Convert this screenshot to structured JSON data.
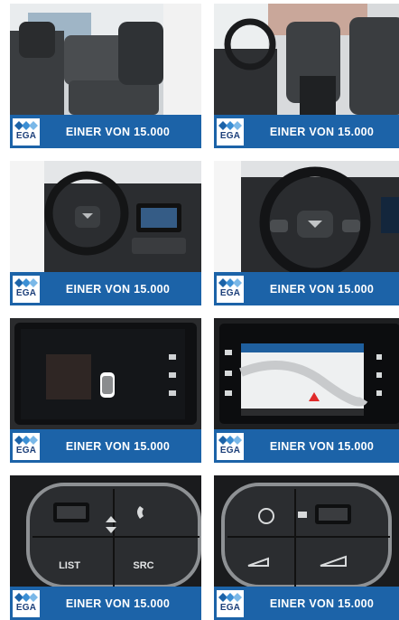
{
  "gallery": {
    "brand": {
      "logo_text": "EGA",
      "banner_color": "#1c63a8",
      "logo_color": "#1c3f7a"
    },
    "cards": [
      {
        "photo": "rear-seats",
        "tagline": "EINER VON 15.000"
      },
      {
        "photo": "front-seats",
        "tagline": "EINER VON 15.000"
      },
      {
        "photo": "cockpit-wide",
        "tagline": "EINER VON 15.000"
      },
      {
        "photo": "cockpit-close",
        "tagline": "EINER VON 15.000"
      },
      {
        "photo": "touchscreen-off",
        "tagline": "EINER VON 15.000"
      },
      {
        "photo": "touchscreen-navigation",
        "tagline": "EINER VON 15.000"
      },
      {
        "photo": "steering-wheel-controls-left",
        "tagline": "EINER VON 15.000",
        "labels": [
          "LIST",
          "SRC"
        ]
      },
      {
        "photo": "steering-wheel-controls-right",
        "tagline": "EINER VON 15.000"
      }
    ]
  }
}
